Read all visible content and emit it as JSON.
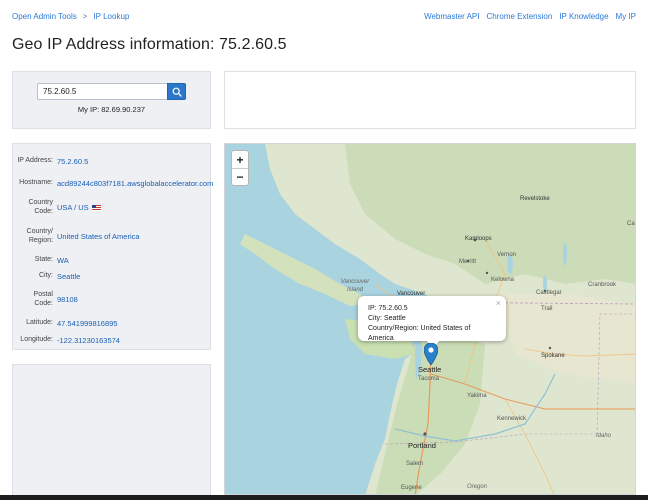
{
  "nav": {
    "breadcrumb": [
      "Open Admin Tools",
      "IP Lookup"
    ],
    "separator": ">",
    "links": [
      "Webmaster API",
      "Chrome Extension",
      "IP Knowledge",
      "My IP"
    ]
  },
  "page_title": "Geo IP Address information: 75.2.60.5",
  "search": {
    "value": "75.2.60.5",
    "icon": "search-icon"
  },
  "my_ip": "My IP: 82.69.90.237",
  "info": {
    "ip_label": "IP Address:",
    "ip": "75.2.60.5",
    "hostname_label": "Hostname:",
    "hostname": "acd89244c803f7181.awsglobalaccelerator.com",
    "country_code_label": "Country Code:",
    "country_code": "USA / US",
    "country_label": "Country/ Region:",
    "country": "United States of America",
    "state_label": "State:",
    "state": "WA",
    "city_label": "City:",
    "city": "Seattle",
    "postal_label": "Postal Code:",
    "postal": "98108",
    "latitude_label": "Latitude:",
    "latitude": "47.541999816895",
    "longitude_label": "Longitude:",
    "longitude": "-122.31230163574"
  },
  "map": {
    "zoom_in": "+",
    "zoom_out": "−",
    "popup": {
      "ip": "IP: 75.2.60.5",
      "city": "City: Seattle",
      "country": "Country/Region: United States of America",
      "close": "×"
    },
    "labels": {
      "kamloops": "Kamloops",
      "revelstoke": "Revelstoke",
      "merritt": "Merritt",
      "vernon": "Vernon",
      "kelowna": "Kelowna",
      "castlegar": "Castlegar",
      "cranbrook": "Cranbrook",
      "trail": "Trail",
      "vancouver_island": "Vancouver Island",
      "vancouver": "Vancouver",
      "seattle": "Seattle",
      "tacoma": "Tacoma",
      "spokane": "Spokane",
      "yakima": "Yakima",
      "kennewick": "Kennewick",
      "portland": "Portland",
      "salem": "Salem",
      "eugene": "Eugene",
      "oregon": "Oregon",
      "idaho": "Idaho",
      "ca": "Ca"
    }
  }
}
